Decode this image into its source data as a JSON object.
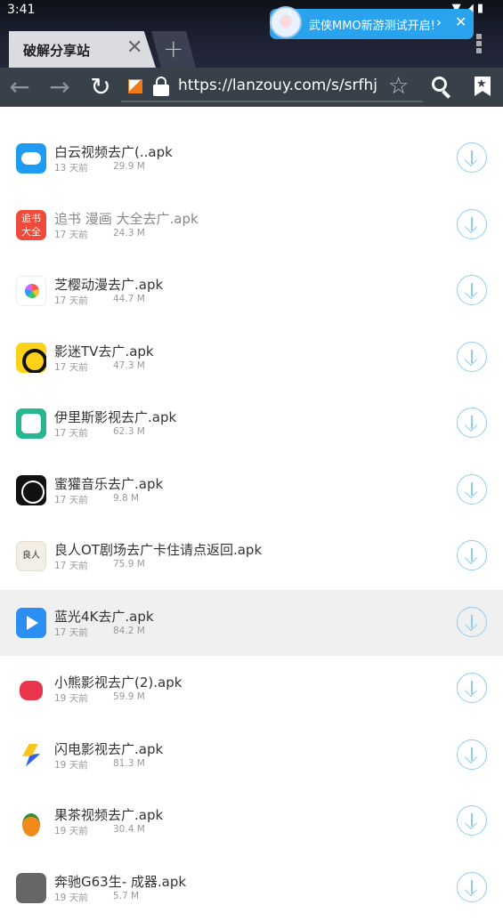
{
  "status_bar": {
    "time": "3:41"
  },
  "browser": {
    "tab_title": "破解分享站",
    "url": "https://lanzouy.com/s/srfhj"
  },
  "toast": {
    "text": "武侠MMO新游测试开启!"
  },
  "files": [
    {
      "name": "白云视频去广(..apk",
      "date": "13 天前",
      "size": "29.9 M",
      "icon": "cloud-icon"
    },
    {
      "name": "追书 漫画 大全去广.apk",
      "date": "17 天前",
      "size": "24.3 M",
      "icon": "zhuishu-icon",
      "icon_text_top": "追书",
      "icon_text_bottom": "大全"
    },
    {
      "name": "芝樱动漫去广.apk",
      "date": "17 天前",
      "size": "44.7 M",
      "icon": "flower-icon"
    },
    {
      "name": "影迷TV去广.apk",
      "date": "17 天前",
      "size": "47.3 M",
      "icon": "yingmi-icon"
    },
    {
      "name": "伊里斯影视去广.apk",
      "date": "17 天前",
      "size": "62.3 M",
      "icon": "panda-icon"
    },
    {
      "name": "蜜獾音乐去广.apk",
      "date": "17 天前",
      "size": "9.8 M",
      "icon": "mihuo-icon"
    },
    {
      "name": "良人OT剧场去广卡住请点返回.apk",
      "date": "17 天前",
      "size": "75.9 M",
      "icon": "liangren-icon",
      "icon_text": "良人"
    },
    {
      "name": "蓝光4K去广.apk",
      "date": "17 天前",
      "size": "84.2 M",
      "icon": "play-icon"
    },
    {
      "name": "小熊影视去广(2).apk",
      "date": "19 天前",
      "size": "59.9 M",
      "icon": "bear-icon"
    },
    {
      "name": "闪电影视去广.apk",
      "date": "19 天前",
      "size": "81.3 M",
      "icon": "flash-icon"
    },
    {
      "name": "果茶视频去广.apk",
      "date": "19 天前",
      "size": "30.4 M",
      "icon": "guocha-icon"
    },
    {
      "name": "奔驰G63生- 成器.apk",
      "date": "19 天前",
      "size": "5.7 M",
      "icon": "car-icon"
    }
  ],
  "colors": {
    "toolbar": "#38404a",
    "accent": "#2aa3ee",
    "download": "#8fcdf0"
  }
}
